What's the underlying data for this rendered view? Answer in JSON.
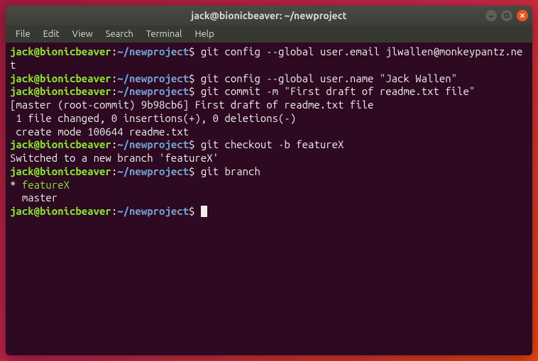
{
  "titlebar": {
    "title": "jack@bionicbeaver: ~/newproject"
  },
  "menubar": {
    "items": [
      "File",
      "Edit",
      "View",
      "Search",
      "Terminal",
      "Help"
    ]
  },
  "prompt": {
    "user_host": "jack@bionicbeaver",
    "colon": ":",
    "path": "~/newproject",
    "dollar": "$"
  },
  "lines": {
    "cmd1": " git config --global user.email jlwallen@monkeypantz.net",
    "cmd2": " git config --global user.name \"Jack Wallen\"",
    "cmd3": " git commit -m \"First draft of readme.txt file\"",
    "out3a": "[master (root-commit) 9b98cb6] First draft of readme.txt file",
    "out3b": " 1 file changed, 0 insertions(+), 0 deletions(-)",
    "out3c": " create mode 100644 readme.txt",
    "cmd4": " git checkout -b featureX",
    "out4a": "Switched to a new branch 'featureX'",
    "cmd5": " git branch",
    "out5a_star": "* ",
    "out5a_branch": "featureX",
    "out5b": "  master",
    "cmd6": " "
  }
}
